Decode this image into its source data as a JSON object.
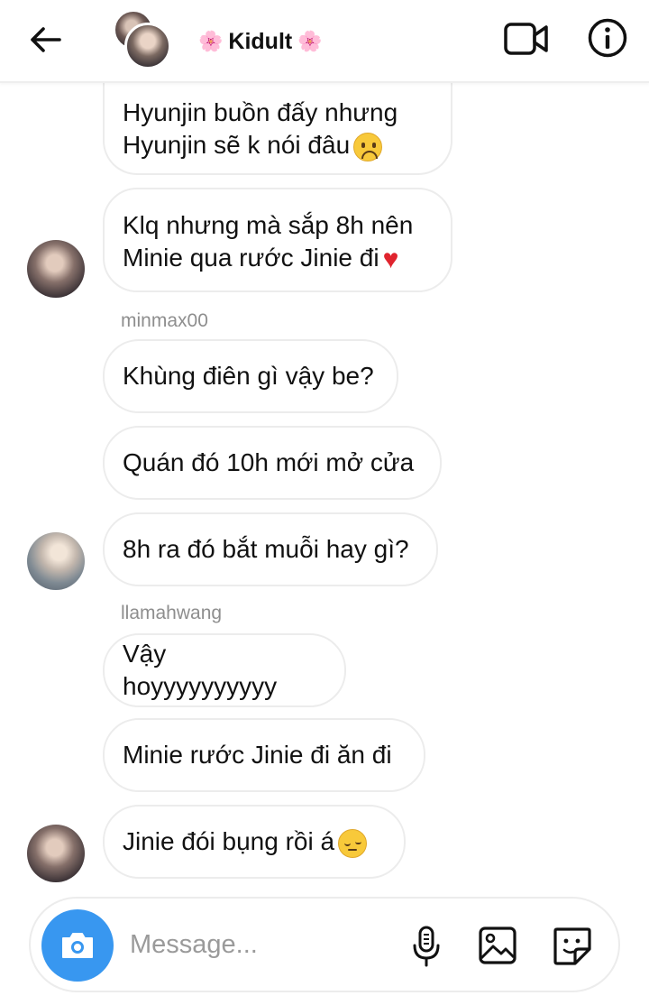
{
  "header": {
    "title": "Kidult",
    "title_decoration_left": "🌸",
    "title_decoration_right": "🌸",
    "back_icon": "arrow-left-icon",
    "video_icon": "video-camera-icon",
    "info_icon": "info-icon"
  },
  "messages": [
    {
      "sender": "",
      "text": "Hyunjin buồn đấy nhưng\nHyunjin sẽ k nói đâu",
      "emoji": "sad-face"
    },
    {
      "sender": "",
      "text": "Klq nhưng mà sắp 8h nên\nMinie qua rước Jinie đi",
      "emoji": "red-heart"
    },
    {
      "sender": "minmax00",
      "text": "Khùng điên gì vậy be?"
    },
    {
      "sender": "",
      "text": "Quán đó 10h mới mở cửa"
    },
    {
      "sender": "",
      "text": "8h ra đó bắt muỗi hay gì?"
    },
    {
      "sender": "llamahwang",
      "text": "Vậy hoyyyyyyyyyy"
    },
    {
      "sender": "",
      "text": "Minie rước Jinie đi ăn đi"
    },
    {
      "sender": "",
      "text": "Jinie đói bụng rồi á",
      "emoji": "pensive-face"
    }
  ],
  "composer": {
    "placeholder": "Message...",
    "camera_icon": "camera-icon",
    "mic_icon": "microphone-icon",
    "gallery_icon": "image-icon",
    "sticker_icon": "sticker-icon",
    "camera_color": "#3897f0"
  }
}
